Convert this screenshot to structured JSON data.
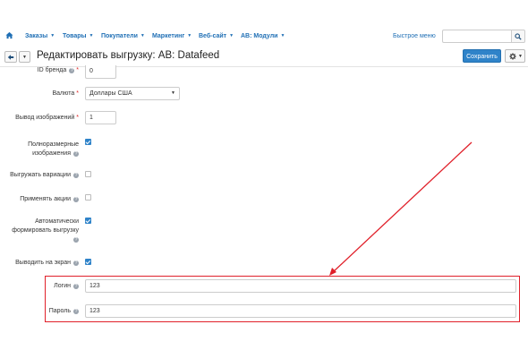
{
  "nav": {
    "items": [
      {
        "label": "Заказы"
      },
      {
        "label": "Товары"
      },
      {
        "label": "Покупатели"
      },
      {
        "label": "Маркетинг"
      },
      {
        "label": "Веб-сайт"
      },
      {
        "label": "AB: Модули"
      }
    ],
    "quick_menu": "Быстрое меню",
    "search": {
      "value": "",
      "placeholder": ""
    }
  },
  "toolbar": {
    "title": "Редактировать выгрузку: AB: Datafeed",
    "save_label": "Сохранить"
  },
  "form": {
    "brand_id": {
      "label": "ID бренда",
      "value": "0"
    },
    "currency": {
      "label": "Валюта",
      "value": "Доллары США"
    },
    "image_output": {
      "label": "Вывод изображений",
      "value": "1"
    },
    "full_size_images": {
      "label_line1": "Полноразмерные",
      "label_line2": "изображения",
      "checked": true
    },
    "export_variations": {
      "label": "Выгружать вариации",
      "checked": false
    },
    "apply_promotions": {
      "label": "Применять акции",
      "checked": false
    },
    "auto_generate": {
      "label_line1": "Автоматически",
      "label_line2": "формировать выгрузку",
      "checked": true
    },
    "display_on_screen": {
      "label": "Выводить на экран",
      "checked": true
    },
    "login": {
      "label": "Логин",
      "value": "123"
    },
    "password": {
      "label": "Пароль",
      "value": "123"
    }
  },
  "colors": {
    "accent": "#2f83c9",
    "link": "#1f6fb5",
    "annotation": "#e0202a"
  }
}
